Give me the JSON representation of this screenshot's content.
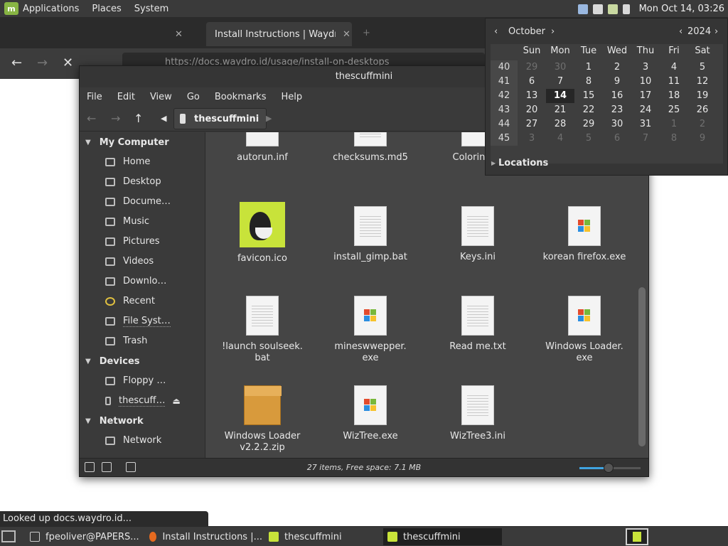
{
  "top_panel": {
    "menus": [
      "Applications",
      "Places",
      "System"
    ],
    "clock": "Mon Oct 14, 03:26"
  },
  "browser": {
    "tab_title": "Install Instructions | Waydro",
    "url": "https://docs.waydro.id/usage/install-on-desktops",
    "status_tooltip": "Looked up docs.waydro.id..."
  },
  "file_manager": {
    "title": "thescuffmini",
    "menu": [
      "File",
      "Edit",
      "View",
      "Go",
      "Bookmarks",
      "Help"
    ],
    "path_button": "thescuffmini",
    "sidebar": {
      "my_computer": {
        "header": "My Computer",
        "items": [
          "Home",
          "Desktop",
          "Docume…",
          "Music",
          "Pictures",
          "Videos",
          "Downlo…",
          "Recent",
          "File Syst…",
          "Trash"
        ]
      },
      "devices": {
        "header": "Devices",
        "items": [
          "Floppy …",
          "thescuff…"
        ]
      },
      "network": {
        "header": "Network",
        "items": [
          "Network"
        ]
      }
    },
    "files": [
      {
        "name": "autorun.inf",
        "icon": "blank-file-icon"
      },
      {
        "name": "checksums.md5",
        "icon": "text-file-icon"
      },
      {
        "name": "ColoringBo",
        "icon": "exe-file-icon"
      },
      {
        "name": "favicon.ico",
        "icon": "dog-image-icon"
      },
      {
        "name": "install_gimp.bat",
        "icon": "text-file-icon"
      },
      {
        "name": "Keys.ini",
        "icon": "text-file-icon"
      },
      {
        "name": "korean firefox.exe",
        "icon": "exe-file-icon"
      },
      {
        "name": "!launch soulseek.\nbat",
        "icon": "text-file-icon"
      },
      {
        "name": "mineswwepper.\nexe",
        "icon": "exe-file-icon"
      },
      {
        "name": "Read me.txt",
        "icon": "text-file-icon"
      },
      {
        "name": "Windows Loader.\nexe",
        "icon": "exe-file-icon"
      },
      {
        "name": "Windows Loader\nv2.2.2.zip",
        "icon": "archive-icon"
      },
      {
        "name": "WizTree.exe",
        "icon": "exe-file-icon"
      },
      {
        "name": "WizTree3.ini",
        "icon": "text-file-icon"
      }
    ],
    "status": "27 items, Free space: 7.1 MB",
    "zoom_level": 0.48
  },
  "calendar": {
    "month": "October",
    "year": "2024",
    "weekdays": [
      "Sun",
      "Mon",
      "Tue",
      "Wed",
      "Thu",
      "Fri",
      "Sat"
    ],
    "weeks": [
      {
        "num": "40",
        "days": [
          "29",
          "30",
          "1",
          "2",
          "3",
          "4",
          "5"
        ],
        "dim": [
          true,
          true,
          false,
          false,
          false,
          false,
          false
        ]
      },
      {
        "num": "41",
        "days": [
          "6",
          "7",
          "8",
          "9",
          "10",
          "11",
          "12"
        ],
        "dim": [
          false,
          false,
          false,
          false,
          false,
          false,
          false
        ]
      },
      {
        "num": "42",
        "days": [
          "13",
          "14",
          "15",
          "16",
          "17",
          "18",
          "19"
        ],
        "dim": [
          false,
          false,
          false,
          false,
          false,
          false,
          false
        ]
      },
      {
        "num": "43",
        "days": [
          "20",
          "21",
          "22",
          "23",
          "24",
          "25",
          "26"
        ],
        "dim": [
          false,
          false,
          false,
          false,
          false,
          false,
          false
        ]
      },
      {
        "num": "44",
        "days": [
          "27",
          "28",
          "29",
          "30",
          "31",
          "1",
          "2"
        ],
        "dim": [
          false,
          false,
          false,
          false,
          false,
          true,
          true
        ]
      },
      {
        "num": "45",
        "days": [
          "3",
          "4",
          "5",
          "6",
          "7",
          "8",
          "9"
        ],
        "dim": [
          true,
          true,
          true,
          true,
          true,
          true,
          true
        ]
      }
    ],
    "today": "14",
    "locations_label": "Locations"
  },
  "taskbar": {
    "tasks": [
      {
        "label": "fpeoliver@PAPERS...",
        "icon": "terminal-icon",
        "active": false
      },
      {
        "label": "Install Instructions |...",
        "icon": "firefox-icon",
        "active": false
      },
      {
        "label": "thescuffmini",
        "icon": "folder-icon",
        "active": false
      },
      {
        "label": "thescuffmini",
        "icon": "folder-icon",
        "active": true
      }
    ]
  },
  "colors": {
    "panel_bg": "#3a3a3a",
    "window_bg": "#3a3a3a",
    "content_bg": "#454545",
    "accent": "#3fa3e0",
    "mint_green": "#88b544"
  }
}
